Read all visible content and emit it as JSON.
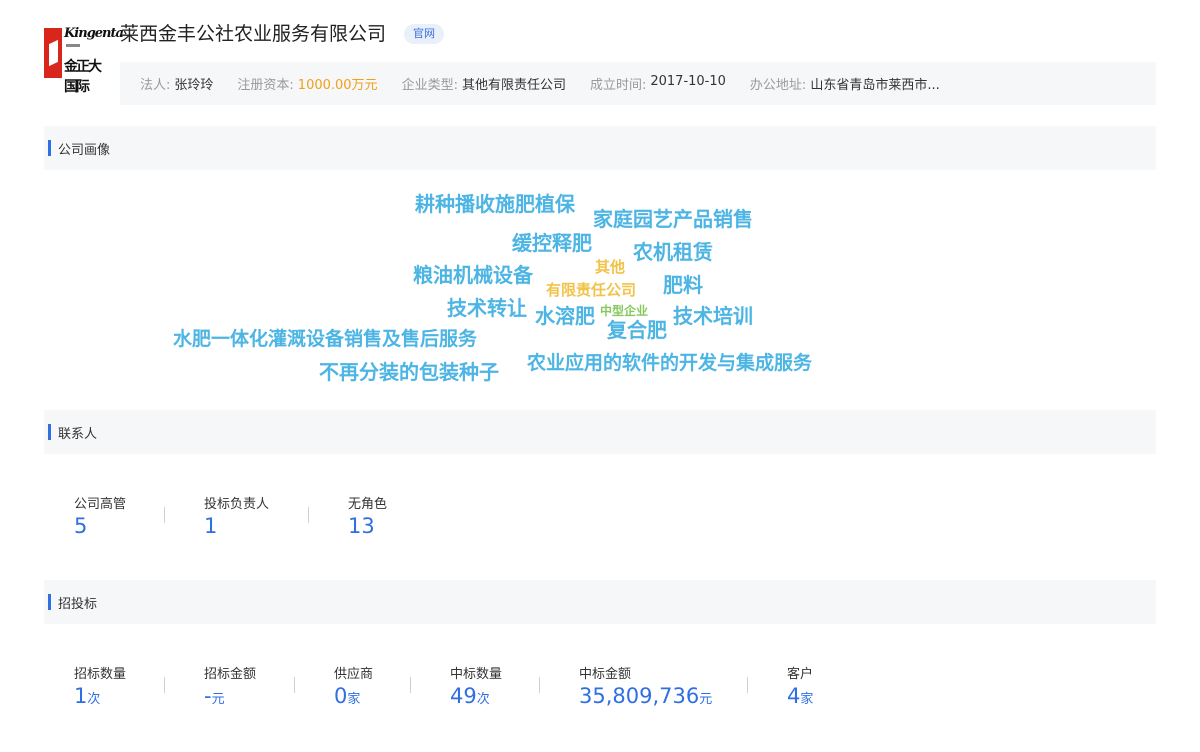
{
  "header": {
    "logo": {
      "en": "Kingenta",
      "cn": "金正大国际"
    },
    "company_name": "莱西金丰公社农业服务有限公司",
    "official_badge": "官网",
    "info": [
      {
        "label": "法人:",
        "value": "张玲玲",
        "highlight": false
      },
      {
        "label": "注册资本:",
        "value": "1000.00万元",
        "highlight": true
      },
      {
        "label": "企业类型:",
        "value": "其他有限责任公司",
        "highlight": false
      },
      {
        "label": "成立时间:",
        "value": "2017-10-10",
        "highlight": false
      },
      {
        "label": "办公地址:",
        "value": "山东省青岛市莱西市...",
        "highlight": false
      }
    ]
  },
  "portrait": {
    "title": "公司画像",
    "words": [
      {
        "text": "耕种播收施肥植保",
        "color": "blue"
      },
      {
        "text": "家庭园艺产品销售",
        "color": "blue"
      },
      {
        "text": "缓控释肥",
        "color": "blue"
      },
      {
        "text": "农机租赁",
        "color": "blue"
      },
      {
        "text": "其他",
        "color": "yellow"
      },
      {
        "text": "粮油机械设备",
        "color": "blue"
      },
      {
        "text": "有限责任公司",
        "color": "yellow"
      },
      {
        "text": "肥料",
        "color": "blue"
      },
      {
        "text": "技术转让",
        "color": "blue"
      },
      {
        "text": "水溶肥",
        "color": "blue"
      },
      {
        "text": "中型企业",
        "color": "green"
      },
      {
        "text": "技术培训",
        "color": "blue"
      },
      {
        "text": "复合肥",
        "color": "blue"
      },
      {
        "text": "水肥一体化灌溉设备销售及售后服务",
        "color": "blue"
      },
      {
        "text": "不再分装的包装种子",
        "color": "blue"
      },
      {
        "text": "农业应用的软件的开发与集成服务",
        "color": "blue"
      }
    ]
  },
  "contacts": {
    "title": "联系人",
    "stats": [
      {
        "label": "公司高管",
        "value": "5",
        "unit": ""
      },
      {
        "label": "投标负责人",
        "value": "1",
        "unit": ""
      },
      {
        "label": "无角色",
        "value": "13",
        "unit": ""
      }
    ]
  },
  "bidding": {
    "title": "招投标",
    "stats": [
      {
        "label": "招标数量",
        "value": "1",
        "unit": "次"
      },
      {
        "label": "招标金额",
        "value": "-",
        "unit": "元"
      },
      {
        "label": "供应商",
        "value": "0",
        "unit": "家"
      },
      {
        "label": "中标数量",
        "value": "49",
        "unit": "次"
      },
      {
        "label": "中标金额",
        "value": "35,809,736",
        "unit": "元"
      },
      {
        "label": "客户",
        "value": "4",
        "unit": "家"
      }
    ]
  }
}
